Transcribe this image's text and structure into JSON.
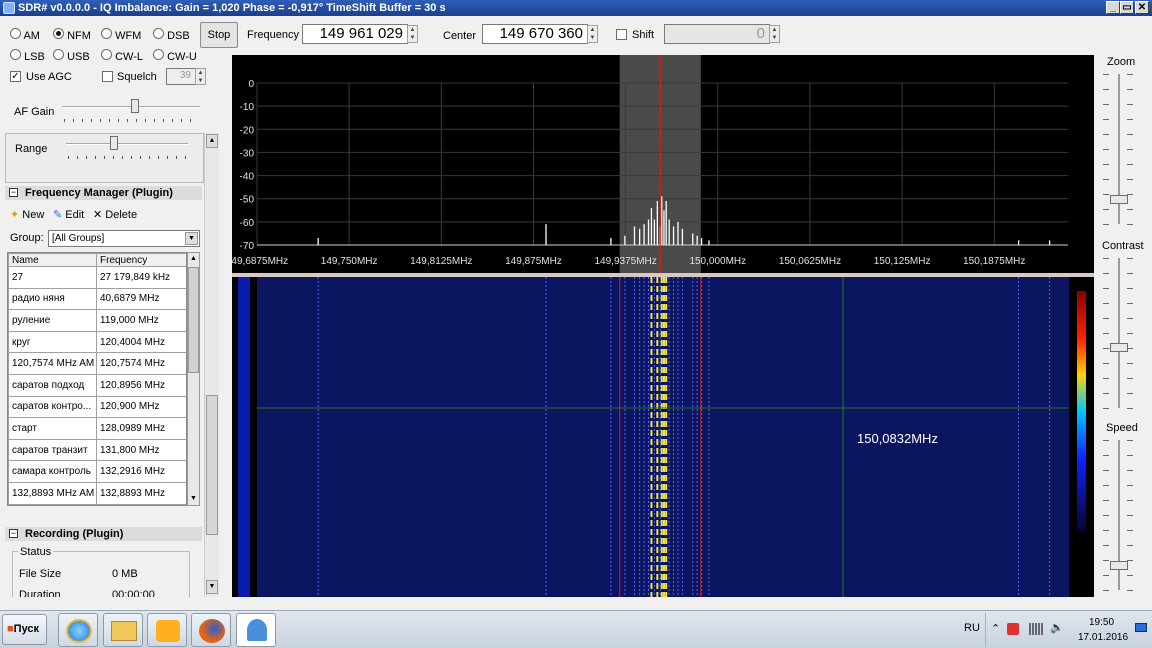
{
  "window": {
    "title": "SDR# v0.0.0.0 - IQ Imbalance: Gain = 1,020 Phase = -0,917° TimeShift Buffer = 30 s",
    "controls": [
      "_",
      "▭",
      "✕"
    ]
  },
  "modes": {
    "row1": [
      {
        "label": "AM",
        "selected": false
      },
      {
        "label": "NFM",
        "selected": true
      },
      {
        "label": "WFM",
        "selected": false
      },
      {
        "label": "DSB",
        "selected": false
      }
    ],
    "row2": [
      {
        "label": "LSB",
        "selected": false
      },
      {
        "label": "USB",
        "selected": false
      },
      {
        "label": "CW-L",
        "selected": false
      },
      {
        "label": "CW-U",
        "selected": false
      }
    ]
  },
  "stop_label": "Stop",
  "frequency": {
    "label": "Frequency",
    "value": "149 961 029"
  },
  "center": {
    "label": "Center",
    "value": "149 670 360"
  },
  "shift": {
    "label": "Shift",
    "value": "0",
    "checked": false
  },
  "agc": {
    "label": "Use AGC",
    "checked": true
  },
  "squelch": {
    "label": "Squelch",
    "checked": false,
    "value": "39"
  },
  "af_gain": {
    "label": "AF Gain",
    "level": 0.53
  },
  "range": {
    "label": "Range",
    "level": 0.4
  },
  "freq_manager": {
    "title": "Frequency Manager (Plugin)",
    "new_label": "New",
    "edit_label": "Edit",
    "delete_label": "Delete",
    "group_label": "Group:",
    "group_value": "[All Groups]",
    "columns": [
      "Name",
      "Frequency"
    ],
    "rows": [
      [
        "27",
        "27 179,849 kHz"
      ],
      [
        "радио няня",
        "40,6879 MHz"
      ],
      [
        "руление",
        "119,000 MHz"
      ],
      [
        "круг",
        "120,4004 MHz"
      ],
      [
        "120,7574 MHz AM",
        "120,7574 MHz"
      ],
      [
        "саратов подход",
        "120,8956 MHz"
      ],
      [
        "саратов контро...",
        "120,900 MHz"
      ],
      [
        "старт",
        "128,0989 MHz"
      ],
      [
        "саратов транзит",
        "131,800 MHz"
      ],
      [
        "самара контроль",
        "132,2916 MHz"
      ],
      [
        "132,8893 MHz AM",
        "132,8893 MHz"
      ]
    ]
  },
  "recording": {
    "title": "Recording (Plugin)",
    "status_label": "Status",
    "file_size_label": "File Size",
    "file_size_value": "0 MB",
    "duration_label": "Duration",
    "duration_value": "00:00:00"
  },
  "chart_data": {
    "type": "line",
    "y_ticks": [
      "0",
      "-10",
      "-20",
      "-30",
      "-40",
      "-50",
      "-60",
      "-70"
    ],
    "ylim": [
      -70,
      0
    ],
    "x_ticks": [
      "149,6875MHz",
      "149,750MHz",
      "149,8125MHz",
      "149,875MHz",
      "149,9375MHz",
      "150,000MHz",
      "150,0625MHz",
      "150,125MHz",
      "150,1875MHz"
    ],
    "x_tick_values": [
      149.6875,
      149.75,
      149.8125,
      149.875,
      149.9375,
      150.0,
      150.0625,
      150.125,
      150.1875
    ],
    "xlim": [
      149.6875,
      150.2375
    ],
    "tuned_frequency": 149.961029,
    "filter_band": [
      149.9335,
      149.9885
    ],
    "peaks": [
      [
        149.729,
        -67
      ],
      [
        149.8835,
        -61
      ],
      [
        149.9275,
        -67
      ],
      [
        149.937,
        -66
      ],
      [
        149.9435,
        -62
      ],
      [
        149.947,
        -63
      ],
      [
        149.95,
        -61
      ],
      [
        149.953,
        -59
      ],
      [
        149.955,
        -54
      ],
      [
        149.957,
        -59
      ],
      [
        149.959,
        -51
      ],
      [
        149.961,
        -62
      ],
      [
        149.962,
        -49
      ],
      [
        149.9635,
        -55
      ],
      [
        149.965,
        -51
      ],
      [
        149.967,
        -59
      ],
      [
        149.97,
        -62
      ],
      [
        149.973,
        -60
      ],
      [
        149.976,
        -63
      ],
      [
        149.983,
        -65
      ],
      [
        149.986,
        -66
      ],
      [
        149.989,
        -67
      ],
      [
        149.994,
        -68
      ],
      [
        150.204,
        -68
      ],
      [
        150.225,
        -68
      ]
    ],
    "noise_floor": -70
  },
  "waterfall": {
    "cursor_label": "150,0832MHz"
  },
  "zoom_label": "Zoom",
  "contrast_label": "Contrast",
  "speed_label": "Speed",
  "taskbar": {
    "start_label": "Пуск",
    "lang": "RU",
    "time": "19:50",
    "date": "17.01.2016"
  }
}
